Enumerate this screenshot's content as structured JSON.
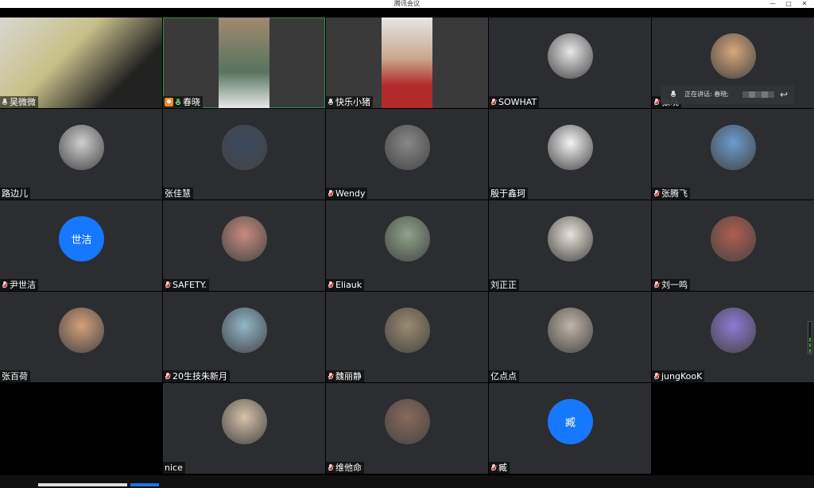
{
  "window": {
    "title": "腾讯会议",
    "controls": [
      "—",
      "□",
      "✕"
    ]
  },
  "speaking_bar": {
    "label": "正在讲话: 春晓;"
  },
  "participants": [
    {
      "name": "吴微微",
      "mic": "on",
      "type": "video"
    },
    {
      "name": "春晓",
      "mic": "active",
      "type": "video",
      "host": true
    },
    {
      "name": "快乐小猪",
      "mic": "on",
      "type": "video"
    },
    {
      "name": "SOWHAT",
      "mic": "muted",
      "type": "avatar"
    },
    {
      "name": "张晓",
      "mic": "muted",
      "type": "avatar"
    },
    {
      "name": "路边儿",
      "mic": "none",
      "type": "avatar"
    },
    {
      "name": "张佳慧",
      "mic": "none",
      "type": "avatar"
    },
    {
      "name": "Wendy",
      "mic": "muted",
      "type": "avatar"
    },
    {
      "name": "殷于鑫珂",
      "mic": "none",
      "type": "avatar"
    },
    {
      "name": "张腾飞",
      "mic": "muted",
      "type": "avatar"
    },
    {
      "name": "尹世洁",
      "mic": "muted",
      "type": "text-avatar",
      "avatar_text": "世洁"
    },
    {
      "name": "SAFETY.",
      "mic": "muted",
      "type": "avatar"
    },
    {
      "name": "Eliauk",
      "mic": "muted",
      "type": "avatar"
    },
    {
      "name": "刘正正",
      "mic": "none",
      "type": "avatar"
    },
    {
      "name": "刘一鸣",
      "mic": "muted",
      "type": "avatar"
    },
    {
      "name": "张百荷",
      "mic": "none",
      "type": "avatar"
    },
    {
      "name": "20生技朱新月",
      "mic": "muted",
      "type": "avatar"
    },
    {
      "name": "魏丽静",
      "mic": "muted",
      "type": "avatar"
    },
    {
      "name": "亿点点",
      "mic": "none",
      "type": "avatar"
    },
    {
      "name": "jungKooK",
      "mic": "muted",
      "type": "avatar"
    },
    {
      "name": "nice",
      "mic": "none",
      "type": "avatar"
    },
    {
      "name": "维他命",
      "mic": "muted",
      "type": "avatar"
    },
    {
      "name": "臧",
      "mic": "muted",
      "type": "text-avatar",
      "avatar_text": "臧"
    }
  ],
  "colors": {
    "tile_bg": "#2b2d30",
    "text_avatar_bg": "#1677ff",
    "speaking_outline": "#2f8f4e",
    "muted_slash": "#e53935"
  }
}
